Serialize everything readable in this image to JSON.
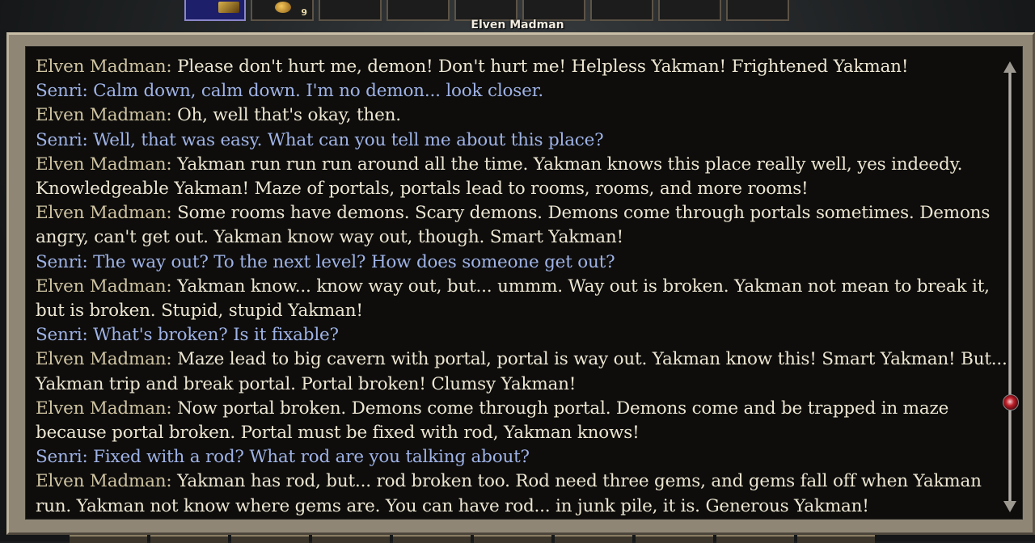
{
  "quickbar": {
    "slots": [
      {
        "count": ""
      },
      {
        "count": "9"
      },
      {
        "count": ""
      },
      {
        "count": ""
      },
      {
        "count": ""
      },
      {
        "count": ""
      },
      {
        "count": ""
      },
      {
        "count": ""
      },
      {
        "count": ""
      },
      {
        "count": ""
      }
    ]
  },
  "dialog": {
    "speaker": "Elven Madman",
    "entries": [
      {
        "speaker": "Elven Madman:",
        "type": "npc",
        "text": "Please don't hurt me, demon! Don't hurt me! Helpless Yakman! Frightened Yakman!"
      },
      {
        "speaker": "Senri:",
        "type": "pc",
        "text": "Calm down, calm down. I'm no demon... look closer."
      },
      {
        "speaker": "Elven Madman:",
        "type": "npc",
        "text": "Oh, well that's okay, then."
      },
      {
        "speaker": "Senri:",
        "type": "pc",
        "text": "Well, that was easy. What can you tell me about this place?"
      },
      {
        "speaker": "Elven Madman:",
        "type": "npc",
        "text": "Yakman run run run around all the time. Yakman knows this place really well, yes indeedy. Knowledgeable Yakman! Maze of portals, portals lead to rooms, rooms, and more rooms!"
      },
      {
        "speaker": "Elven Madman:",
        "type": "npc",
        "text": "Some rooms have demons. Scary demons. Demons come through portals sometimes. Demons angry, can't get out. Yakman know way out, though. Smart Yakman!"
      },
      {
        "speaker": "Senri:",
        "type": "pc",
        "text": "The way out? To the next level? How does someone get out?"
      },
      {
        "speaker": "Elven Madman:",
        "type": "npc",
        "text": "Yakman know... know way out, but... ummm. Way out is broken. Yakman not mean to break it, but is broken. Stupid, stupid Yakman!"
      },
      {
        "speaker": "Senri:",
        "type": "pc",
        "text": "What's broken? Is it fixable?"
      },
      {
        "speaker": "Elven Madman:",
        "type": "npc",
        "text": "Maze lead to big cavern with portal, portal is way out. Yakman know this! Smart Yakman! But... Yakman trip and break portal. Portal broken! Clumsy Yakman!"
      },
      {
        "speaker": "Elven Madman:",
        "type": "npc",
        "text": "Now portal broken. Demons come through portal. Demons come and be trapped in maze because portal broken. Portal must be fixed with rod, Yakman knows!"
      },
      {
        "speaker": "Senri:",
        "type": "pc",
        "text": "Fixed with a rod? What rod are you talking about?"
      },
      {
        "speaker": "Elven Madman:",
        "type": "npc",
        "text": "Yakman has rod, but... rod broken too. Rod need three gems, and gems fall off when Yakman run. Yakman not know where gems are. You can have rod... in junk pile, it is. Generous Yakman!"
      }
    ]
  },
  "colors": {
    "npc_name": "#cfc4a2",
    "pc_name": "#9fb3e6",
    "npc_text": "#ece6d2"
  }
}
